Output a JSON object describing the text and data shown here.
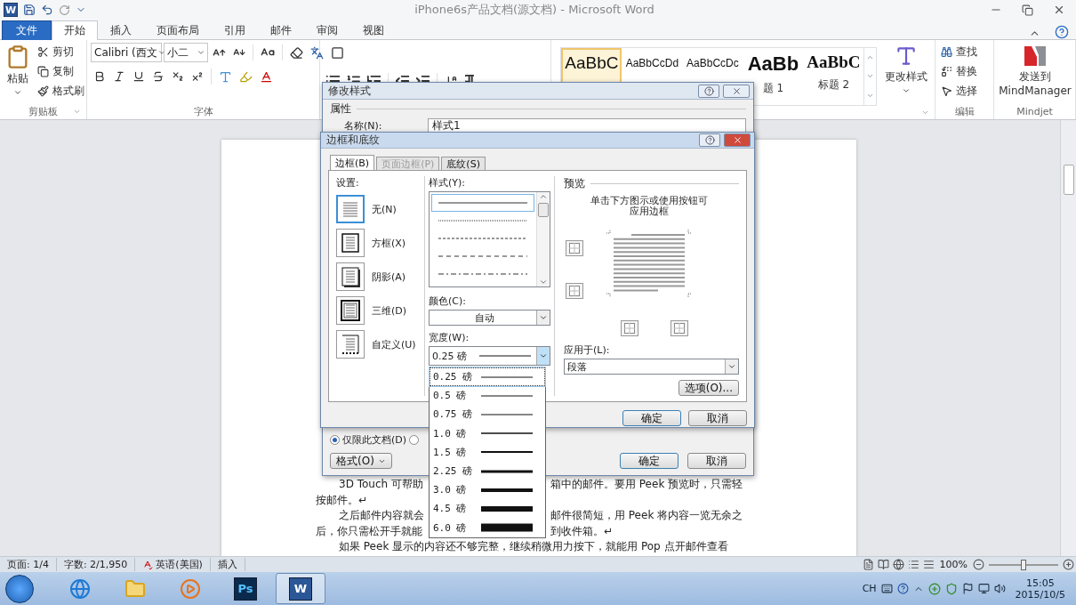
{
  "window": {
    "title": "iPhone6s产品文档(源文档) - Microsoft Word",
    "app_letter": "W"
  },
  "ribbon_tabs": [
    {
      "label": "文件",
      "kind": "file",
      "selected": false
    },
    {
      "label": "开始",
      "kind": "tab",
      "selected": true
    },
    {
      "label": "插入",
      "kind": "tab",
      "selected": false
    },
    {
      "label": "页面布局",
      "kind": "tab",
      "selected": false
    },
    {
      "label": "引用",
      "kind": "tab",
      "selected": false
    },
    {
      "label": "邮件",
      "kind": "tab",
      "selected": false
    },
    {
      "label": "审阅",
      "kind": "tab",
      "selected": false
    },
    {
      "label": "视图",
      "kind": "tab",
      "selected": false
    }
  ],
  "clipboard": {
    "paste": "粘贴",
    "items": [
      "剪切",
      "复制",
      "格式刷"
    ],
    "group": "剪贴板"
  },
  "font": {
    "name": "Calibri (西文",
    "size": "小二",
    "group": "字体"
  },
  "styles_gallery": [
    {
      "sample": "AaBbC",
      "kind": "normal",
      "selected": true
    },
    {
      "sample": "AaBbCcDd",
      "kind": "small",
      "selected": false
    },
    {
      "sample": "AaBbCcDc",
      "kind": "small",
      "selected": false
    },
    {
      "sample": "AaBb",
      "label": "题 1",
      "kind": "heading1",
      "selected": false
    },
    {
      "sample": "AaBbC",
      "label": "标题 2",
      "kind": "heading2",
      "selected": false
    }
  ],
  "change_styles": "更改样式",
  "editing": {
    "items": [
      "查找",
      "替换",
      "选择"
    ],
    "group": "编辑"
  },
  "mindjet": {
    "button": "发送到 MindManager",
    "group": "Mindjet"
  },
  "document": {
    "lines": [
      {
        "left": "3D Touch 可帮助",
        "right": "箱中的邮件。要用 Peek 预览时，只需轻"
      },
      {
        "left": "按邮件。↵"
      },
      {
        "left": "之后邮件内容就会",
        "right": "邮件很简短，用 Peek 将内容一览无余之"
      },
      {
        "left": "后，你只需松开手就能",
        "right": "到收件箱。↵"
      },
      {
        "left": "如果 Peek 显示的内容还不够完整，继续稍微用力按下，就能用 Pop 点开邮件查看"
      }
    ]
  },
  "modify_style_dialog": {
    "title": "修改样式",
    "section": "属性",
    "name_label": "名称(N):",
    "name_value": "样式1",
    "scope_options": [
      {
        "label": "仅限此文档(D)",
        "selected": true
      },
      {
        "selected": false
      }
    ],
    "format_button": "格式(O)",
    "ok": "确定",
    "cancel": "取消"
  },
  "borders_dialog": {
    "title": "边框和底纹",
    "tabs": [
      {
        "label": "边框(B)",
        "selected": true,
        "disabled": false
      },
      {
        "label": "页面边框(P)",
        "selected": false,
        "disabled": true
      },
      {
        "label": "底纹(S)",
        "selected": false,
        "disabled": false
      }
    ],
    "setting_label": "设置:",
    "settings": [
      {
        "label": "无(N)",
        "kind": "none",
        "selected": true
      },
      {
        "label": "方框(X)",
        "kind": "box",
        "selected": false
      },
      {
        "label": "阴影(A)",
        "kind": "shadow",
        "selected": false
      },
      {
        "label": "三维(D)",
        "kind": "threed",
        "selected": false
      },
      {
        "label": "自定义(U)",
        "kind": "custom",
        "selected": false
      }
    ],
    "style_label": "样式(Y):",
    "line_styles": [
      {
        "kind": "solid",
        "selected": true
      },
      {
        "kind": "dotted",
        "selected": false
      },
      {
        "kind": "dashed",
        "selected": false
      },
      {
        "kind": "longdash",
        "selected": false
      },
      {
        "kind": "dashdot",
        "selected": false
      }
    ],
    "color_label": "颜色(C):",
    "color_value": "自动",
    "width_label": "宽度(W):",
    "width_value": "0.25 磅",
    "width_options": [
      {
        "label": "0.25 磅",
        "selected": true
      },
      {
        "label": "0.5 磅",
        "selected": false
      },
      {
        "label": "0.75 磅",
        "selected": false
      },
      {
        "label": "1.0 磅",
        "selected": false
      },
      {
        "label": "1.5 磅",
        "selected": false
      },
      {
        "label": "2.25 磅",
        "selected": false
      },
      {
        "label": "3.0 磅",
        "selected": false
      },
      {
        "label": "4.5 磅",
        "selected": false
      },
      {
        "label": "6.0 磅",
        "selected": false
      }
    ],
    "preview_label": "预览",
    "preview_hint": "单击下方图示或使用按钮可应用边框",
    "apply_label": "应用于(L):",
    "apply_value": "段落",
    "options_button": "选项(O)...",
    "ok": "确定",
    "cancel": "取消"
  },
  "status_bar": {
    "items": [
      "页面: 1/4",
      "字数: 2/1,950",
      "英语(美国)",
      "插入"
    ],
    "zoom": "100%",
    "zoom_level": {
      "level": 0.5
    }
  },
  "taskbar": {
    "apps": [
      {
        "kind": "ie",
        "active": false
      },
      {
        "kind": "folder",
        "active": false
      },
      {
        "kind": "media",
        "active": false
      },
      {
        "kind": "ps",
        "label": "Ps",
        "active": false
      },
      {
        "kind": "word",
        "label": "W",
        "active": true
      }
    ],
    "language": "CH",
    "time": "15:05",
    "date": "2015/10/5"
  }
}
